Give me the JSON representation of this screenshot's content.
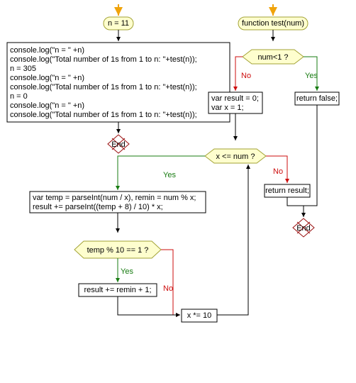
{
  "left": {
    "start_label": "n = 11",
    "body_lines": [
      "console.log(\"n = \" +n)",
      "console.log(\"Total number of 1s from 1 to n: \"+test(n));",
      "n = 305",
      "console.log(\"n = \" +n)",
      "console.log(\"Total number of 1s from 1 to n: \"+test(n));",
      "n = 0",
      "console.log(\"n = \" +n)",
      "console.log(\"Total number of 1s from 1 to n: \"+test(n));"
    ],
    "end_label": "End"
  },
  "right": {
    "func_label": "function test(num)",
    "cond1": "num<1 ?",
    "yes": "Yes",
    "no": "No",
    "init_block": [
      "var result = 0;",
      "var x = 1;"
    ],
    "ret_false": "return false;",
    "loop_cond": "x <= num ?",
    "loop_body": [
      "var temp = parseInt(num / x), remin = num % x;",
      "result += parseInt((temp + 8) / 10) * x;"
    ],
    "inner_cond": "temp % 10 == 1 ?",
    "inner_yes_box": "result += remin + 1;",
    "step_box": "x *= 10",
    "ret_result": "return result;",
    "end_label": "End"
  },
  "colors": {
    "start_fill": "#fefece",
    "start_stroke": "#a3a336",
    "box_fill": "#ffffff",
    "box_stroke": "#000000",
    "diamond_fill": "#fefece",
    "diamond_stroke": "#a3a336",
    "end_fill": "#ffffff",
    "end_stroke": "#990d0d",
    "edge": "#000000",
    "edge_yes": "#177b11",
    "edge_no": "#cd0d0d",
    "entry_arrow": "#f0a30a"
  }
}
